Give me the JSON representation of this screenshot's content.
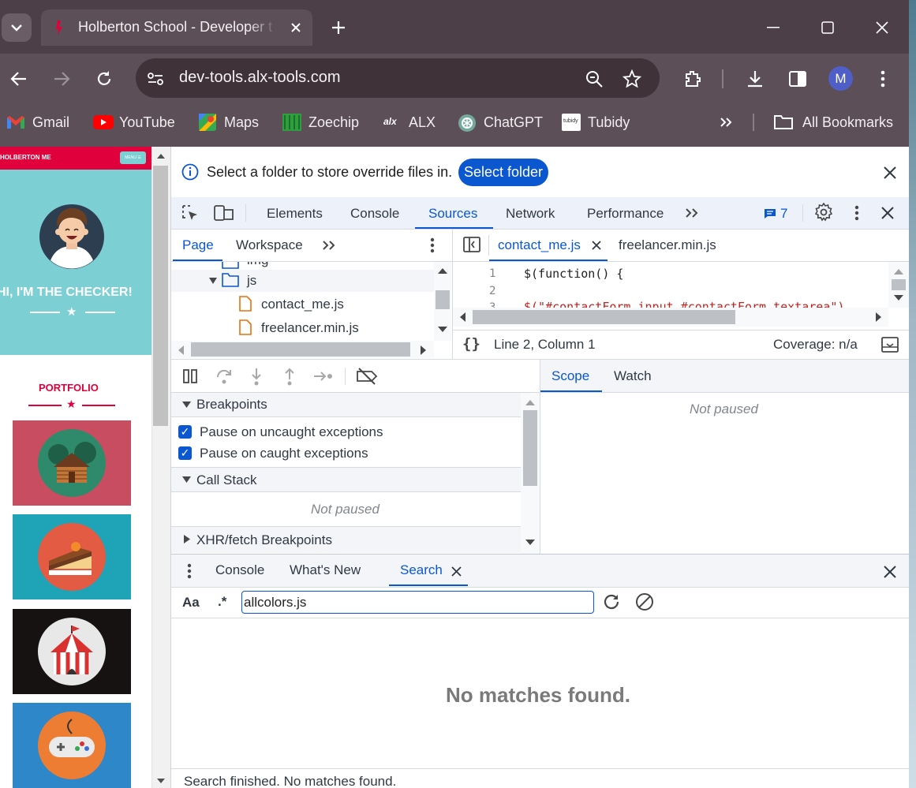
{
  "browser": {
    "tab_title": "Holberton School - Developer t",
    "url": "dev-tools.alx-tools.com",
    "profile_initial": "M",
    "bookmarks": [
      {
        "label": "Gmail",
        "color": "#ea4335"
      },
      {
        "label": "YouTube",
        "color": "#ff0000"
      },
      {
        "label": "Maps",
        "color": "#34a853"
      },
      {
        "label": "Zoechip",
        "color": "#2e9e3e"
      },
      {
        "label": "ALX",
        "color": "#111111"
      },
      {
        "label": "ChatGPT",
        "color": "#74aa9c"
      },
      {
        "label": "Tubidy",
        "color": "#ffffff"
      }
    ],
    "all_bookmarks": "All Bookmarks"
  },
  "site": {
    "brand": "HOLBERTON ME",
    "menu": "MENU ☰",
    "headline": "HI, I'M THE CHECKER!",
    "portfolio": "PORTFOLIO",
    "accent": "#e0003c",
    "hero_color": "#7ccfd3",
    "tiles": [
      {
        "name": "cabin",
        "color": "#c84d60"
      },
      {
        "name": "cake",
        "color": "#1fa3b6"
      },
      {
        "name": "circus",
        "color": "#161212"
      },
      {
        "name": "gamepad",
        "color": "#2e87c8"
      }
    ]
  },
  "devtools": {
    "infobar": {
      "text": "Select a folder to store override files in.",
      "button": "Select folder"
    },
    "tabs": [
      "Elements",
      "Console",
      "Sources",
      "Network",
      "Performance"
    ],
    "active_tab": "Sources",
    "issues_count": "7",
    "navigator_tabs": [
      "Page",
      "Workspace"
    ],
    "tree": {
      "partial": "img",
      "folder": "js",
      "files": [
        "contact_me.js",
        "freelancer.min.js"
      ]
    },
    "editor_tabs": [
      "contact_me.js",
      "freelancer.min.js"
    ],
    "code_lines": [
      {
        "num": "1",
        "code": "$(function() {"
      },
      {
        "num": "2",
        "code": ""
      },
      {
        "num": "3",
        "code": "  $(\"#contactForm input,#contactForm textarea\")."
      }
    ],
    "status_position": "Line 2, Column 1",
    "coverage": "Coverage: n/a",
    "debug": {
      "breakpoints_label": "Breakpoints",
      "pause_uncaught": "Pause on uncaught exceptions",
      "pause_caught": "Pause on caught exceptions",
      "call_stack_label": "Call Stack",
      "call_stack_status": "Not paused",
      "xhr_label": "XHR/fetch Breakpoints",
      "scope_tab": "Scope",
      "watch_tab": "Watch",
      "scope_status": "Not paused"
    },
    "drawer": {
      "tabs": [
        "Console",
        "What's New",
        "Search"
      ],
      "active": "Search",
      "case_toggle": "Aa",
      "regex_toggle": ".*",
      "query": "allcolors.js",
      "no_matches": "No matches found.",
      "footer": "Search finished.  No matches found."
    }
  }
}
